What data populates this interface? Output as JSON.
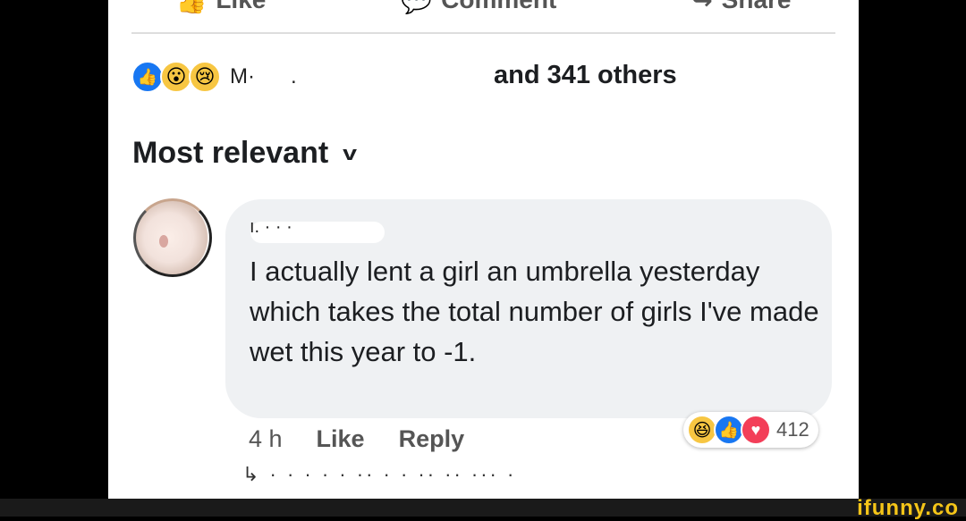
{
  "actions": {
    "like": "Like",
    "comment": "Comment",
    "share": "Share"
  },
  "reactions_summary": {
    "icons": [
      "like-icon",
      "wow-icon",
      "sad-icon"
    ],
    "name": "M·",
    "dot": ".",
    "others": "and 341 others"
  },
  "sort": {
    "label": "Most relevant",
    "chevron": "chevron-down-icon"
  },
  "comment": {
    "author_mark": "ı.   ·  ·  ·",
    "text": "I actually lent a girl an umbrella yesterday which takes the total number of girls I've made wet this year to -1.",
    "time": "4 h",
    "like_label": "Like",
    "reply_label": "Reply",
    "reaction_icons": [
      "haha-icon",
      "like-icon",
      "love-icon"
    ],
    "reaction_count": "412"
  },
  "replies": {
    "text": "↳   ·   ·  · ·  ·  ·· · ·  ·· ·· ··· ·"
  },
  "watermark": "ifunny.co"
}
